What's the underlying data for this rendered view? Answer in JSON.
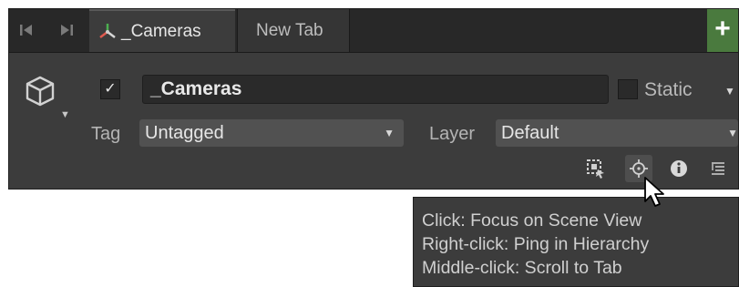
{
  "tabs": [
    {
      "label": "_Cameras",
      "icon": "unity-scene-icon"
    },
    {
      "label": "New Tab"
    }
  ],
  "add_tab_symbol": "+",
  "gameobject": {
    "active_check": "✓",
    "name": "_Cameras",
    "static_label": "Static"
  },
  "tag": {
    "label": "Tag",
    "value": "Untagged"
  },
  "layer": {
    "label": "Layer",
    "value": "Default"
  },
  "tooltip": {
    "lines": [
      "Click: Focus on Scene View",
      "Right-click: Ping in Hierarchy",
      "Middle-click: Scroll to Tab"
    ]
  },
  "colors": {
    "panel": "#3c3c3c",
    "tabbar": "#282828",
    "add_button": "#4a7a3e"
  }
}
